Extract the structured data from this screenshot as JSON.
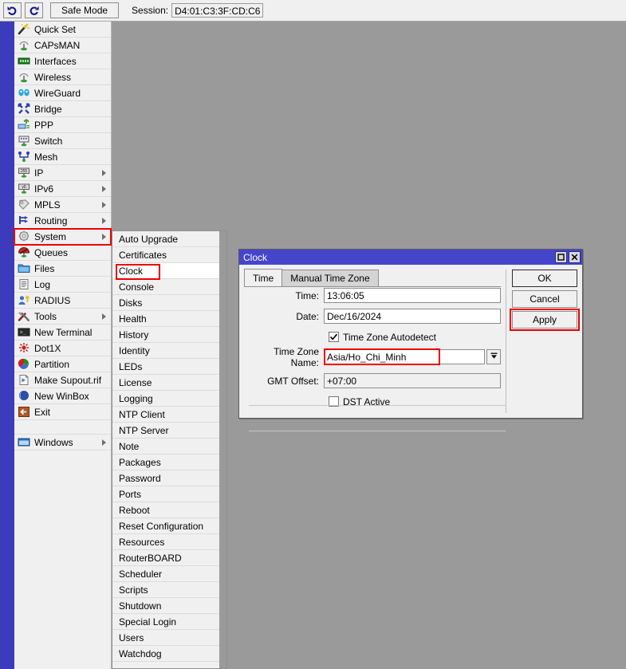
{
  "toolbar": {
    "undo_icon": "undo-arrow-icon",
    "redo_icon": "redo-arrow-icon",
    "safe_mode_label": "Safe Mode",
    "session_label": "Session:",
    "session_value": "D4:01:C3:3F:CD:C6"
  },
  "sidebar": {
    "items": [
      {
        "label": "Quick Set",
        "icon": "wand-icon",
        "arrow": false
      },
      {
        "label": "CAPsMAN",
        "icon": "antenna-icon",
        "arrow": false
      },
      {
        "label": "Interfaces",
        "icon": "nic-card-icon",
        "arrow": false
      },
      {
        "label": "Wireless",
        "icon": "antenna-icon",
        "arrow": false
      },
      {
        "label": "WireGuard",
        "icon": "wireguard-icon",
        "arrow": false
      },
      {
        "label": "Bridge",
        "icon": "bridge-icon",
        "arrow": false
      },
      {
        "label": "PPP",
        "icon": "ppp-icon",
        "arrow": false
      },
      {
        "label": "Switch",
        "icon": "switch-icon",
        "arrow": false
      },
      {
        "label": "Mesh",
        "icon": "mesh-icon",
        "arrow": false
      },
      {
        "label": "IP",
        "icon": "ip-255-icon",
        "arrow": true
      },
      {
        "label": "IPv6",
        "icon": "ipv6-icon",
        "arrow": true
      },
      {
        "label": "MPLS",
        "icon": "mpls-tag-icon",
        "arrow": true
      },
      {
        "label": "Routing",
        "icon": "routing-icon",
        "arrow": true
      },
      {
        "label": "System",
        "icon": "gear-icon",
        "arrow": true,
        "highlighted": true
      },
      {
        "label": "Queues",
        "icon": "queues-icon",
        "arrow": false
      },
      {
        "label": "Files",
        "icon": "folder-icon",
        "arrow": false
      },
      {
        "label": "Log",
        "icon": "log-icon",
        "arrow": false
      },
      {
        "label": "RADIUS",
        "icon": "radius-user-icon",
        "arrow": false
      },
      {
        "label": "Tools",
        "icon": "tools-icon",
        "arrow": true
      },
      {
        "label": "New Terminal",
        "icon": "terminal-icon",
        "arrow": false
      },
      {
        "label": "Dot1X",
        "icon": "dot1x-icon",
        "arrow": false
      },
      {
        "label": "Partition",
        "icon": "partition-icon",
        "arrow": false
      },
      {
        "label": "Make Supout.rif",
        "icon": "supout-file-icon",
        "arrow": false
      },
      {
        "label": "New WinBox",
        "icon": "winbox-icon",
        "arrow": false
      },
      {
        "label": "Exit",
        "icon": "exit-icon",
        "arrow": false
      }
    ],
    "bottom_items": [
      {
        "label": "Windows",
        "icon": "window-icon",
        "arrow": true
      }
    ]
  },
  "system_submenu": {
    "items": [
      {
        "label": "Auto Upgrade"
      },
      {
        "label": "Certificates"
      },
      {
        "label": "Clock",
        "selected": true,
        "highlighted": true
      },
      {
        "label": "Console"
      },
      {
        "label": "Disks"
      },
      {
        "label": "Health"
      },
      {
        "label": "History"
      },
      {
        "label": "Identity"
      },
      {
        "label": "LEDs"
      },
      {
        "label": "License"
      },
      {
        "label": "Logging"
      },
      {
        "label": "NTP Client"
      },
      {
        "label": "NTP Server"
      },
      {
        "label": "Note"
      },
      {
        "label": "Packages"
      },
      {
        "label": "Password"
      },
      {
        "label": "Ports"
      },
      {
        "label": "Reboot"
      },
      {
        "label": "Reset Configuration"
      },
      {
        "label": "Resources"
      },
      {
        "label": "RouterBOARD"
      },
      {
        "label": "Scheduler"
      },
      {
        "label": "Scripts"
      },
      {
        "label": "Shutdown"
      },
      {
        "label": "Special Login"
      },
      {
        "label": "Users"
      },
      {
        "label": "Watchdog"
      }
    ]
  },
  "clock_dialog": {
    "title": "Clock",
    "maximize_icon": "maximize-icon",
    "close_icon": "close-icon",
    "tabs": [
      {
        "label": "Time",
        "active": true
      },
      {
        "label": "Manual Time Zone",
        "active": false
      }
    ],
    "fields": {
      "time_label": "Time:",
      "time_value": "13:06:05",
      "date_label": "Date:",
      "date_value": "Dec/16/2024",
      "tz_autodetect_label": "Time Zone Autodetect",
      "tz_autodetect_checked": true,
      "tz_name_label": "Time Zone Name:",
      "tz_name_value": "Asia/Ho_Chi_Minh",
      "tz_dropdown_icon": "chevron-down-icon",
      "gmt_offset_label": "GMT Offset:",
      "gmt_offset_value": "+07:00",
      "dst_active_label": "DST Active",
      "dst_active_checked": false
    },
    "buttons": [
      {
        "label": "OK",
        "default": true,
        "highlighted": false
      },
      {
        "label": "Cancel",
        "default": false,
        "highlighted": false
      },
      {
        "label": "Apply",
        "default": false,
        "highlighted": true
      }
    ]
  },
  "colors": {
    "titlebar": "#4545cc",
    "sidebar_accent": "#3b3bbb",
    "highlight_red": "#ee0000",
    "workspace": "#9a9a9a",
    "panel": "#f0f0f0"
  }
}
